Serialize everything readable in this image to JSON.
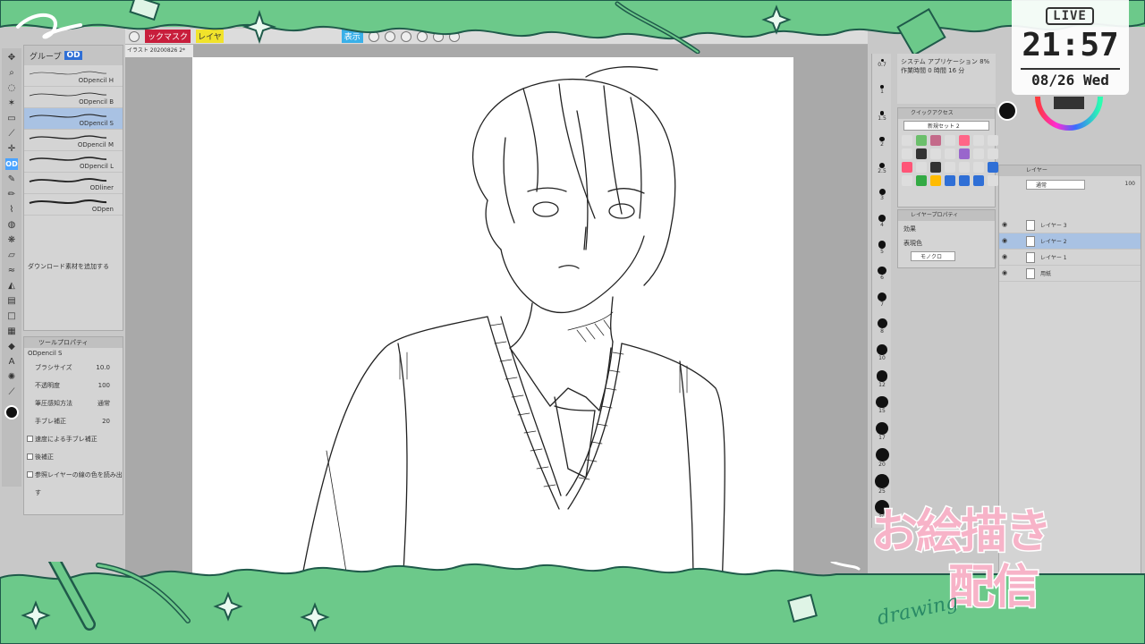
{
  "menubar": {
    "mask_label": "ックマスク",
    "layer_label": "レイヤ",
    "display_label": "表示"
  },
  "document": {
    "tab_label": "イラスト 20200826 2*"
  },
  "subtool": {
    "tabs": [
      "グループ",
      "OD"
    ],
    "brushes": [
      {
        "name": "ODpencil H",
        "active": false
      },
      {
        "name": "ODpencil B",
        "active": false
      },
      {
        "name": "ODpencil S",
        "active": true
      },
      {
        "name": "ODpencil M",
        "active": false
      },
      {
        "name": "ODpencil L",
        "active": false
      },
      {
        "name": "ODliner",
        "active": false
      },
      {
        "name": "ODpen",
        "active": false
      }
    ],
    "add_material": "ダウンロード素材を追加する"
  },
  "toolprop": {
    "header": "ツールプロパティ",
    "brush_name": "ODpencil S",
    "rows": [
      {
        "label": "ブラシサイズ",
        "value": "10.0"
      },
      {
        "label": "不透明度",
        "value": "100"
      },
      {
        "label": "筆圧感知方法",
        "value": "通常"
      },
      {
        "label": "手ブレ補正",
        "value": "20"
      },
      {
        "label": "速度による手ブレ補正",
        "value": ""
      },
      {
        "label": "後補正",
        "value": ""
      },
      {
        "label": "参照レイヤーの線の色を読み出す",
        "value": ""
      }
    ]
  },
  "sizebar": {
    "sizes": [
      "0.7",
      "1",
      "1.5",
      "2",
      "2.5",
      "3",
      "4",
      "5",
      "6",
      "7",
      "8",
      "10",
      "12",
      "15",
      "17",
      "20",
      "25",
      "30"
    ]
  },
  "navinfo": {
    "line1": "システム  アプリケーション  8%",
    "line2": "作業時間       0 時間 16 分"
  },
  "quick": {
    "header": "クイックアクセス",
    "set_label": "新規セット 2",
    "colors": [
      "#dddddd",
      "#6bbf6b",
      "#c46a8a",
      "#dddddd",
      "#ff6688",
      "#dddddd",
      "#dddddd",
      "#dddddd",
      "#333333",
      "#dddddd",
      "#dddddd",
      "#9966cc",
      "#dddddd",
      "#dddddd",
      "#ff5577",
      "#dddddd",
      "#333333",
      "#dddddd",
      "#dddddd",
      "#dddddd",
      "#2f6fd6",
      "#dddddd",
      "#33aa44",
      "#ffbb00",
      "#2f6fd6",
      "#2f6fd6",
      "#2f6fd6",
      "#dddddd"
    ]
  },
  "layerprop": {
    "header": "レイヤープロパティ",
    "effect_label": "効果",
    "color_label": "表現色",
    "color_value": "モノクロ"
  },
  "layers": {
    "header": "レイヤー",
    "mode": "通常",
    "opacity": "100",
    "items": [
      {
        "name": "レイヤー 3",
        "active": false
      },
      {
        "name": "レイヤー 2",
        "active": true
      },
      {
        "name": "レイヤー 1",
        "active": false
      },
      {
        "name": "用紙",
        "active": false
      }
    ]
  },
  "clock": {
    "live": "LIVE",
    "time": "21:57",
    "date": "08/26 Wed"
  },
  "stream_title": {
    "line1": "お絵描き",
    "line2": "配信",
    "script": "drawing"
  },
  "colors": {
    "frame_green": "#6cc98a",
    "frame_dark": "#1f5a4a",
    "canvas": "#ffffff",
    "highlight": "#a9c2e3",
    "title_pink": "#f7b3c8"
  }
}
